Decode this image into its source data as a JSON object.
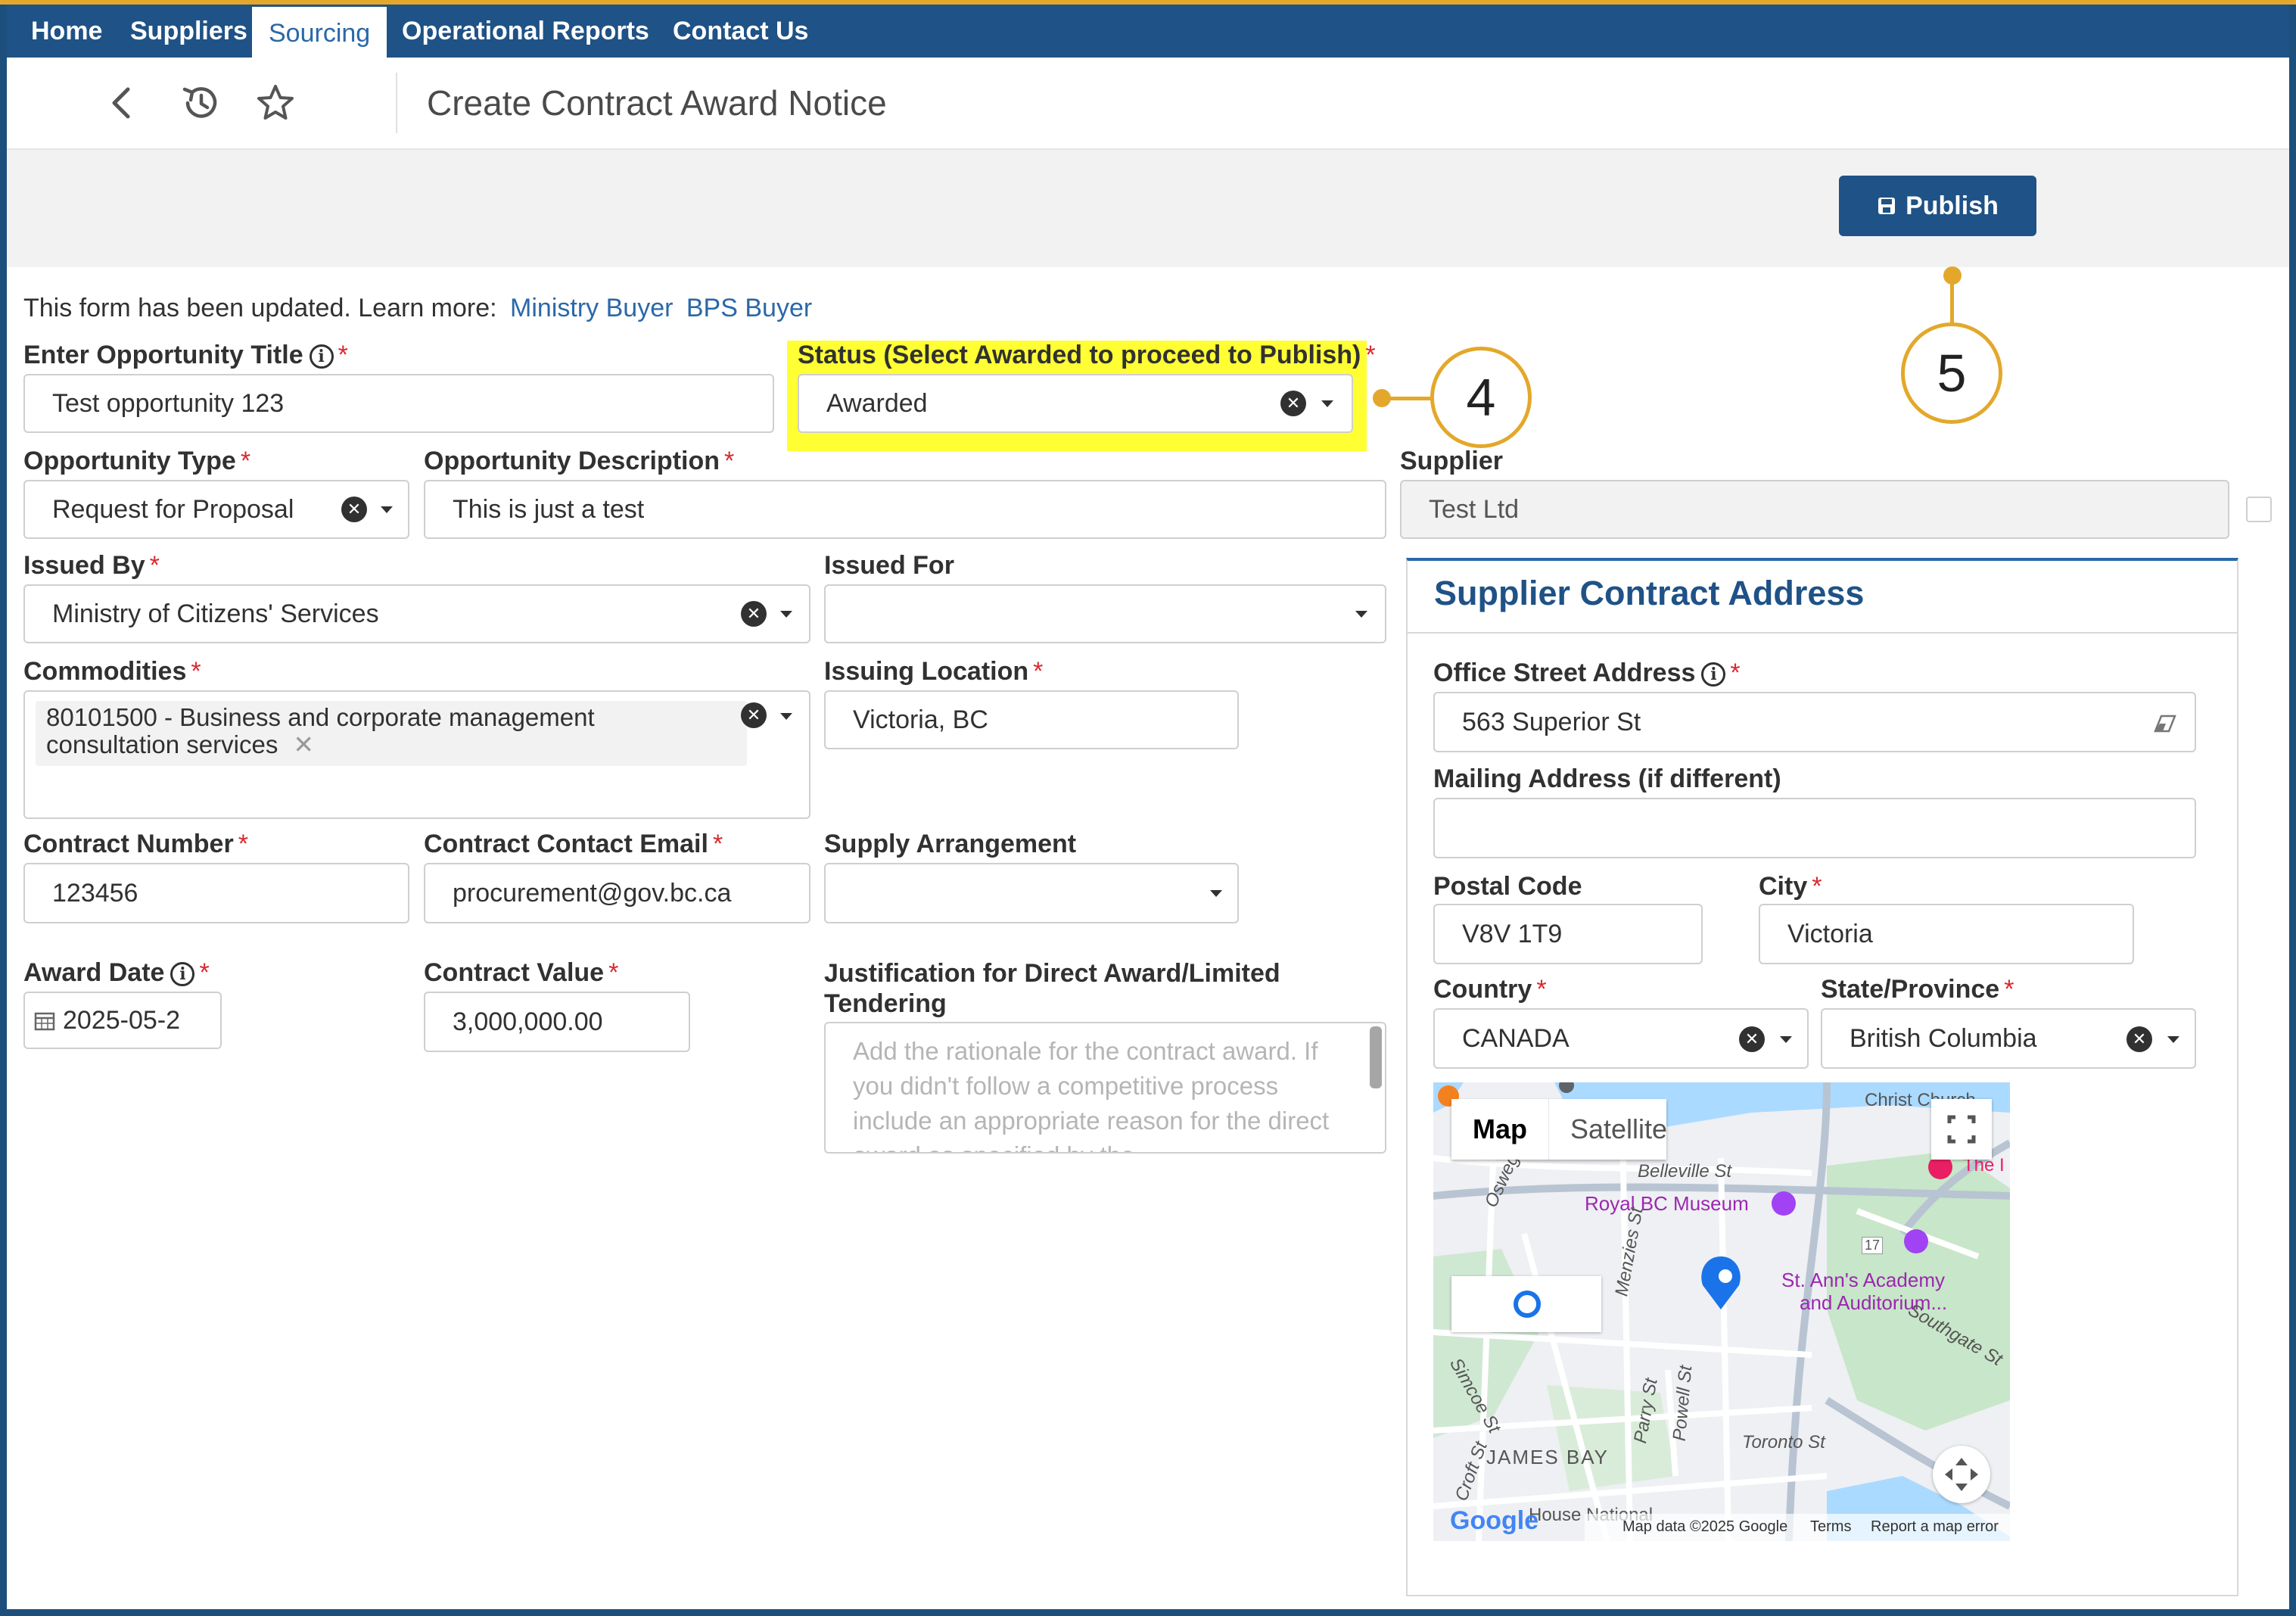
{
  "nav": {
    "items": [
      {
        "label": "Home"
      },
      {
        "label": "Suppliers"
      },
      {
        "label": "Sourcing"
      },
      {
        "label": "Operational Reports"
      },
      {
        "label": "Contact Us"
      }
    ],
    "active": "Sourcing"
  },
  "header": {
    "back_icon": "chevron-left-icon",
    "history_icon": "history-icon",
    "favorite_icon": "star-icon",
    "title": "Create Contract Award Notice"
  },
  "toolbar": {
    "publish_label": "Publish",
    "publish_icon": "save-icon"
  },
  "callouts": {
    "status": "4",
    "publish": "5"
  },
  "notice": {
    "text": "This form has been updated. Learn more:",
    "link1": "Ministry Buyer",
    "link2": "BPS Buyer"
  },
  "form": {
    "title_label": "Enter Opportunity Title",
    "title_value": "Test opportunity 123",
    "status_label": "Status (Select Awarded to proceed to Publish)",
    "status_value": "Awarded",
    "type_label": "Opportunity Type",
    "type_value": "Request for Proposal",
    "desc_label": "Opportunity Description",
    "desc_value": "This is just a test",
    "supplier_label": "Supplier",
    "supplier_value": "Test Ltd",
    "issued_by_label": "Issued By",
    "issued_by_value": "Ministry of Citizens' Services",
    "issued_for_label": "Issued For",
    "issued_for_value": "",
    "commodities_label": "Commodities",
    "commodities_tag_line1": "80101500 - Business and corporate management",
    "commodities_tag_line2": "consultation services",
    "issuing_location_label": "Issuing Location",
    "issuing_location_value": "Victoria, BC",
    "contract_number_label": "Contract Number",
    "contract_number_value": "123456",
    "contract_email_label": "Contract Contact Email",
    "contract_email_value": "procurement@gov.bc.ca",
    "supply_arrangement_label": "Supply Arrangement",
    "supply_arrangement_value": "",
    "award_date_label": "Award Date",
    "award_date_value": "2025-05-2",
    "contract_value_label": "Contract Value",
    "contract_value_value": "3,000,000.00",
    "justification_label_line1": "Justification for Direct Award/Limited",
    "justification_label_line2": "Tendering",
    "justification_placeholder": "Add the rationale for the contract award. If you didn't follow a competitive process include an appropriate reason for the direct award as specified by the"
  },
  "supplier_address": {
    "title": "Supplier Contract Address",
    "street_label": "Office Street Address",
    "street_value": "563 Superior St",
    "mailing_label": "Mailing Address (if different)",
    "mailing_value": "",
    "postal_label": "Postal Code",
    "postal_value": "V8V 1T9",
    "city_label": "City",
    "city_value": "Victoria",
    "country_label": "Country",
    "country_value": "CANADA",
    "state_label": "State/Province",
    "state_value": "British Columbia"
  },
  "map": {
    "tab_map": "Map",
    "tab_satellite": "Satellite",
    "labels": {
      "belleville": "Belleville St",
      "royal_bc": "Royal BC Museum",
      "st_anns_1": "St. Ann's Academy",
      "st_anns_2": "and Auditorium...",
      "james_bay": "JAMES BAY",
      "toronto": "Toronto St",
      "southgate": "Southgate St",
      "menzies": "Menzies St",
      "christ": "Christ Church",
      "the": "The I",
      "simcoe": "Simcoe St",
      "croft": "Croft St",
      "parry": "Parry St",
      "powell": "Powell St",
      "oswego": "Oswego",
      "house_national": "House National",
      "route_17": "17"
    },
    "footer": {
      "google": "Google",
      "data": "Map data ©2025 Google",
      "terms": "Terms",
      "report": "Report a map error"
    }
  },
  "colors": {
    "nav_bg": "#1f5286",
    "accent_gold": "#e3a82b",
    "highlight": "#ffff33",
    "link": "#2a68a8",
    "required": "#d8292f"
  }
}
